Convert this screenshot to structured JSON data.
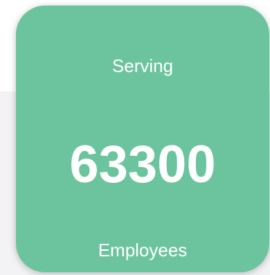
{
  "stat_card": {
    "top_label": "Serving",
    "value": "63300",
    "bottom_label": "Employees",
    "background_color": "#6cc49f",
    "text_color": "#ffffff"
  },
  "background": {
    "panel_color": "#f3f3f6"
  }
}
